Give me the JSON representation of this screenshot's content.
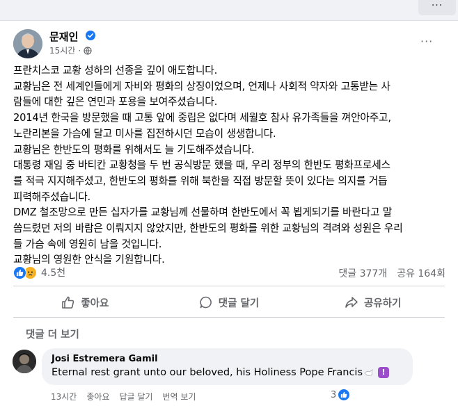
{
  "top_more_label": "···",
  "post": {
    "author": "문재인",
    "time": "15시간",
    "separator": "·",
    "more_label": "···",
    "body": [
      "프란치스코 교황 성하의 선종을 깊이 애도합니다.",
      "교황님은 전 세계인들에게 자비와 평화의 상징이었으며, 언제나 사회적 약자와 고통받는 사",
      "람들에 대한 깊은 연민과 포용을 보여주셨습니다.",
      "2014년 한국을 방문했을 때 고통 앞에 중립은 없다며 세월호 참사 유가족들을 껴안아주고,",
      "노란리본을 가슴에 달고 미사를 집전하시던 모습이 생생합니다.",
      "교황님은 한반도의 평화를 위해서도 늘 기도해주셨습니다.",
      "대통령 재임 중 바티칸 교황청을 두 번 공식방문 했을 때, 우리 정부의 한반도 평화프로세스",
      "를 적극 지지해주셨고, 한반도의 평화를 위해 북한을 직접 방문할 뜻이 있다는 의지를 거듭",
      "피력해주셨습니다.",
      "DMZ 철조망으로 만든 십자가를 교황님께 선물하며 한반도에서 꼭 뵙게되기를 바란다고 말",
      "씀드렸던 저의 바람은 이뤄지지 않았지만, 한반도의 평화를 위한 교황님의 격려와 성원은 우리",
      "들 가슴 속에 영원히 남을 것입니다.",
      "교황님의 영원한 안식을 기원합니다."
    ],
    "reactions_count": "4.5천",
    "comments_count": "댓글 377개",
    "shares_count": "공유 164회"
  },
  "actions": {
    "like": "좋아요",
    "comment": "댓글 달기",
    "share": "공유하기"
  },
  "more_comments": "댓글 더 보기",
  "comment": {
    "author": "Josi Estremera Gamil",
    "text": "Eternal rest grant unto our beloved, his Holiness Pope Francis",
    "time": "13시간",
    "like": "좋아요",
    "reply": "답글 달기",
    "translate": "번역 보기",
    "reaction_count": "3"
  },
  "colors": {
    "accent": "#1877f2",
    "text": "#050505",
    "secondary": "#65676b",
    "background": "#f0f2f5"
  }
}
